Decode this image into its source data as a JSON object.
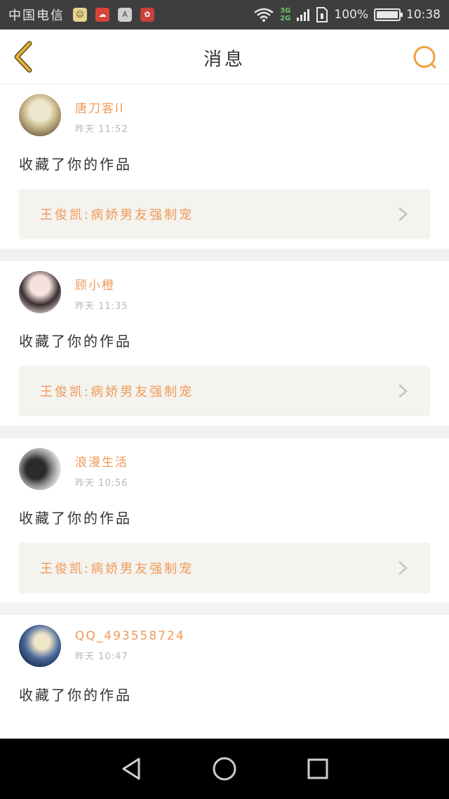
{
  "status": {
    "carrier": "中国电信",
    "network_top": "3G",
    "network_bottom": "2G",
    "battery": "100%",
    "time": "10:38",
    "notif_icons": [
      "emoji-app-icon",
      "cloud-app-icon",
      "a-app-icon",
      "huawei-app-icon"
    ]
  },
  "header": {
    "title": "消息"
  },
  "messages": [
    {
      "username": "唐刀客ll",
      "time": "昨天 11:52",
      "action": "收藏了你的作品",
      "work_title": "王俊凯:病娇男友强制宠"
    },
    {
      "username": "顾小橙",
      "time": "昨天 11:35",
      "action": "收藏了你的作品",
      "work_title": "王俊凯:病娇男友强制宠"
    },
    {
      "username": "浪漫生活",
      "time": "昨天 10:56",
      "action": "收藏了你的作品",
      "work_title": "王俊凯:病娇男友强制宠"
    },
    {
      "username": "QQ_493558724",
      "time": "昨天 10:47",
      "action": "收藏了你的作品",
      "work_title": ""
    }
  ],
  "colors": {
    "accent": "#f09a5a",
    "header_icon": "#f0a040",
    "back_icon": "#e6b33a"
  }
}
